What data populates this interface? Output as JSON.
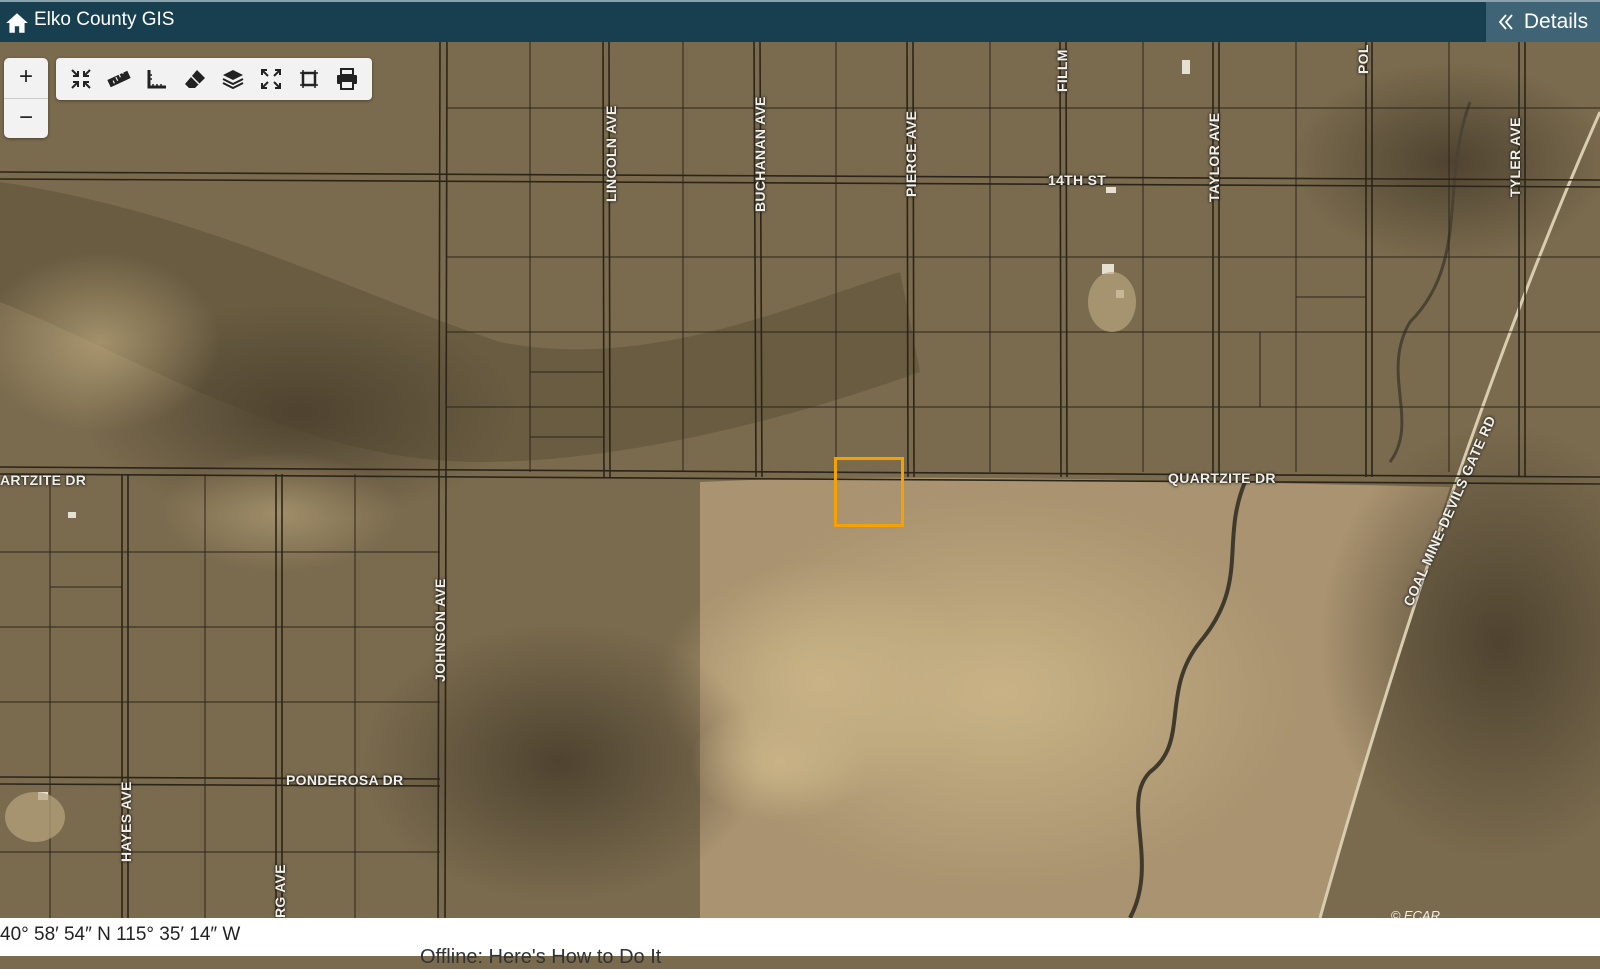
{
  "app": {
    "title": "Elko County GIS",
    "details_label": "Details"
  },
  "zoom": {
    "in": "+",
    "out": "−"
  },
  "toolbar": [
    "collapse-icon",
    "ruler-icon",
    "angle-icon",
    "eraser-icon",
    "layers-icon",
    "fullscreen-icon",
    "extent-icon",
    "print-icon"
  ],
  "roads": {
    "lincoln": "LINCOLN AVE",
    "buchanan": "BUCHANAN AVE",
    "pierce": "PIERCE AVE",
    "fillm": "FILLM",
    "taylor": "TAYLOR AVE",
    "pol": "POL",
    "tyler": "TYLER AVE",
    "fourteenth": "14TH ST",
    "quartzite_left": "ARTZITE DR",
    "quartzite_right": "QUARTZITE DR",
    "coal_mine": "COAL MINE-DEVILS GATE RD",
    "johnson": "JOHNSON AVE",
    "ponderosa": "PONDEROSA DR",
    "hayes": "HAYES AVE",
    "rg": "RG AVE"
  },
  "copyright": "© ECAR",
  "coordinates": "40° 58′ 54″ N 115° 35′ 14″ W",
  "behind_text": "Offline: Here's How to Do It",
  "colors": {
    "header": "#173f4f",
    "details": "#3e6476",
    "selection": "#f5a200"
  }
}
